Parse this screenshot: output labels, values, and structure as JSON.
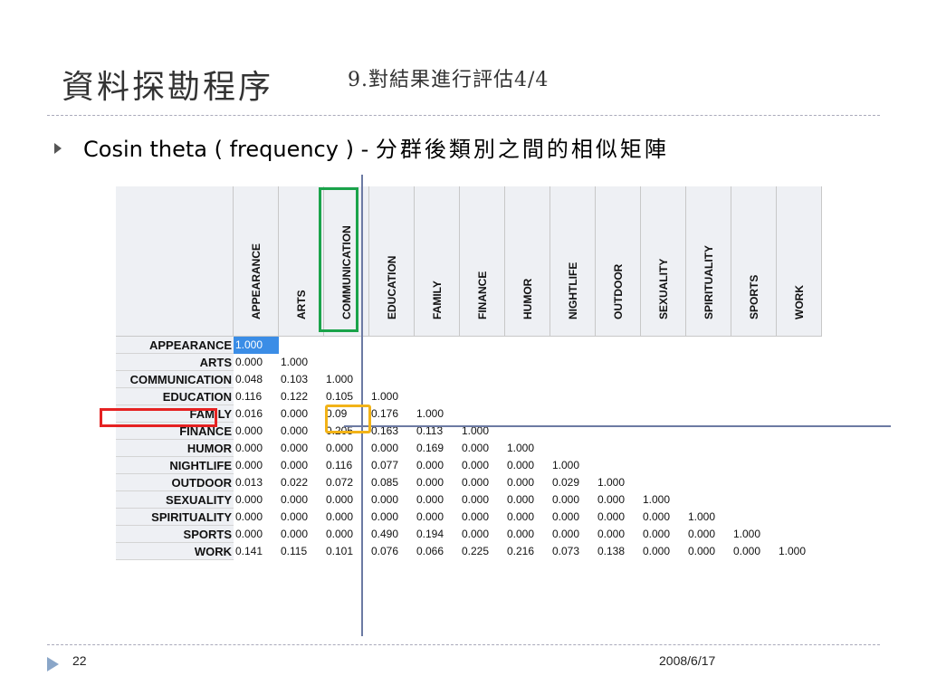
{
  "slide": {
    "title": "資料探勘程序",
    "subtitle": "9.對結果進行評估4/4",
    "bullet_latin": "Cosin theta ( frequency ) - ",
    "bullet_cjk": "分群後類別之間的相似矩陣",
    "page_number": "22",
    "date": "2008/6/17"
  },
  "matrix": {
    "columns": [
      "APPEARANCE",
      "ARTS",
      "COMMUNICATION",
      "EDUCATION",
      "FAMILY",
      "FINANCE",
      "HUMOR",
      "NIGHTLIFE",
      "OUTDOOR",
      "SEXUALITY",
      "SPIRITUALITY",
      "SPORTS",
      "WORK"
    ],
    "rows": [
      {
        "label": "APPEARANCE",
        "values": [
          "1.000"
        ]
      },
      {
        "label": "ARTS",
        "values": [
          "0.000",
          "1.000"
        ]
      },
      {
        "label": "COMMUNICATION",
        "values": [
          "0.048",
          "0.103",
          "1.000"
        ]
      },
      {
        "label": "EDUCATION",
        "values": [
          "0.116",
          "0.122",
          "0.105",
          "1.000"
        ]
      },
      {
        "label": "FAMILY",
        "values": [
          "0.016",
          "0.000",
          "0.09",
          "0.176",
          "1.000"
        ]
      },
      {
        "label": "FINANCE",
        "values": [
          "0.000",
          "0.000",
          "0.205",
          "0.163",
          "0.113",
          "1.000"
        ]
      },
      {
        "label": "HUMOR",
        "values": [
          "0.000",
          "0.000",
          "0.000",
          "0.000",
          "0.169",
          "0.000",
          "1.000"
        ]
      },
      {
        "label": "NIGHTLIFE",
        "values": [
          "0.000",
          "0.000",
          "0.116",
          "0.077",
          "0.000",
          "0.000",
          "0.000",
          "1.000"
        ]
      },
      {
        "label": "OUTDOOR",
        "values": [
          "0.013",
          "0.022",
          "0.072",
          "0.085",
          "0.000",
          "0.000",
          "0.000",
          "0.029",
          "1.000"
        ]
      },
      {
        "label": "SEXUALITY",
        "values": [
          "0.000",
          "0.000",
          "0.000",
          "0.000",
          "0.000",
          "0.000",
          "0.000",
          "0.000",
          "0.000",
          "1.000"
        ]
      },
      {
        "label": "SPIRITUALITY",
        "values": [
          "0.000",
          "0.000",
          "0.000",
          "0.000",
          "0.000",
          "0.000",
          "0.000",
          "0.000",
          "0.000",
          "0.000",
          "1.000"
        ]
      },
      {
        "label": "SPORTS",
        "values": [
          "0.000",
          "0.000",
          "0.000",
          "0.490",
          "0.194",
          "0.000",
          "0.000",
          "0.000",
          "0.000",
          "0.000",
          "0.000",
          "1.000"
        ]
      },
      {
        "label": "WORK",
        "values": [
          "0.141",
          "0.115",
          "0.101",
          "0.076",
          "0.066",
          "0.225",
          "0.216",
          "0.073",
          "0.138",
          "0.000",
          "0.000",
          "0.000",
          "1.000"
        ]
      }
    ],
    "highlight_colors": {
      "column": "#1aa34a",
      "row": "#e52222",
      "cell": "#f2b318",
      "selected_cell": "#3b8de6"
    }
  }
}
